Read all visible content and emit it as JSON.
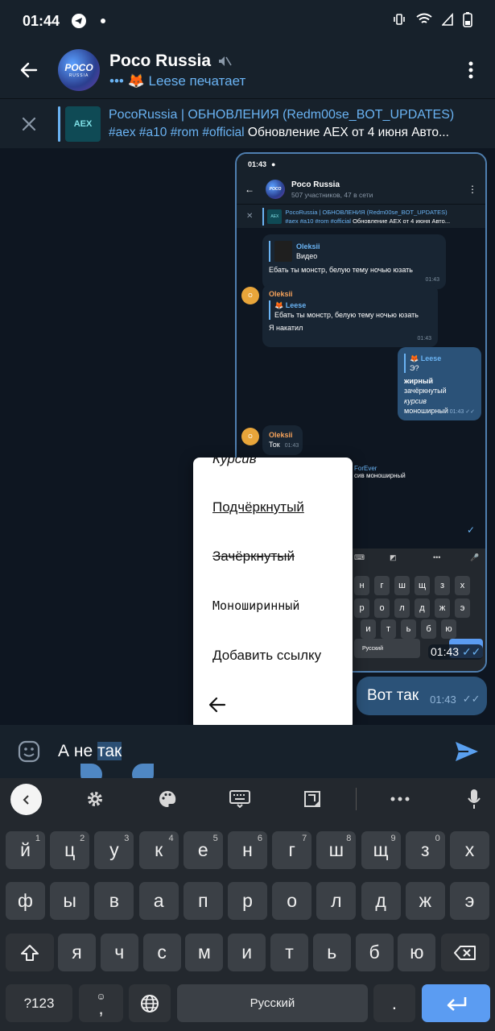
{
  "status_bar": {
    "time": "01:44"
  },
  "header": {
    "title": "Poco Russia",
    "avatar_line1": "POCO",
    "avatar_line2": "RUSSIA",
    "typing": "Leese печатает"
  },
  "pinned": {
    "title": "PocoRussia | ОБНОВЛЕНИЯ (Redm00se_BOT_UPDATES)",
    "tags": "#aex #a10 #rom #official",
    "text": "Обновление AEX от 4 июня Авто..."
  },
  "screenshot": {
    "time": "01:43",
    "title": "Poco Russia",
    "subtitle": "507 участников, 47 в сети",
    "pinned_title": "PocoRussia | ОБНОВЛЕНИЯ (Redm00se_BOT_UPDATES)",
    "pinned_tags": "#aex #a10 #rom #official",
    "pinned_text": "Обновление AEX от 4 июня Авто...",
    "msg1": {
      "quote_name": "Oleksii",
      "quote_text": "Видео",
      "text": "Ебать ты монстр, белую тему ночью юзать",
      "time": "01:43"
    },
    "msg2": {
      "name": "Oleksii",
      "quote_name": "Leese",
      "quote_text": "Ебать ты монстр, белую тему ночью юзать",
      "text": "Я накатил",
      "time": "01:43"
    },
    "msg3": {
      "quote_name": "Leese",
      "quote_text": "Э?",
      "bold": "жирный",
      "strike": "зачёркнутый",
      "italic": "курсив",
      "mono": "моноширный",
      "time": "01:43"
    },
    "msg4": {
      "name": "Oleksii",
      "text": "Ток",
      "time": "01:43"
    },
    "reply_name": "ForEver",
    "reply_text": "сив моноширный",
    "space_label": "Русский",
    "key_row1": [
      "н",
      "г",
      "ш",
      "щ",
      "з",
      "х"
    ],
    "key_row2": [
      "р",
      "о",
      "л",
      "д",
      "ж",
      "э"
    ],
    "key_row3": [
      "и",
      "т",
      "ь",
      "б",
      "ю"
    ]
  },
  "sent": {
    "text": "Вот так",
    "time": "01:43"
  },
  "context_menu": {
    "italic": "Курсив",
    "underline": "Подчёркнутый",
    "strike": "Зачёркнутый",
    "mono": "Моноширинный",
    "link": "Добавить ссылку"
  },
  "input": {
    "before": "А не ",
    "selected": "так"
  },
  "keyboard": {
    "row1": [
      {
        "k": "й",
        "h": "1"
      },
      {
        "k": "ц",
        "h": "2"
      },
      {
        "k": "у",
        "h": "3"
      },
      {
        "k": "к",
        "h": "4"
      },
      {
        "k": "е",
        "h": "5"
      },
      {
        "k": "н",
        "h": "6"
      },
      {
        "k": "г",
        "h": "7"
      },
      {
        "k": "ш",
        "h": "8"
      },
      {
        "k": "щ",
        "h": "9"
      },
      {
        "k": "з",
        "h": "0"
      },
      {
        "k": "х",
        "h": ""
      }
    ],
    "row2": [
      "ф",
      "ы",
      "в",
      "а",
      "п",
      "р",
      "о",
      "л",
      "д",
      "ж",
      "э"
    ],
    "row3": [
      "я",
      "ч",
      "с",
      "м",
      "и",
      "т",
      "ь",
      "б",
      "ю"
    ],
    "sym_label": "?123",
    "comma": ",",
    "space_label": "Русский",
    "period": "."
  },
  "colors": {
    "accent": "#6ab3f3",
    "background": "#0e1621",
    "bar": "#17212b",
    "outgoing": "#2b5278",
    "send": "#5b9cf2"
  }
}
